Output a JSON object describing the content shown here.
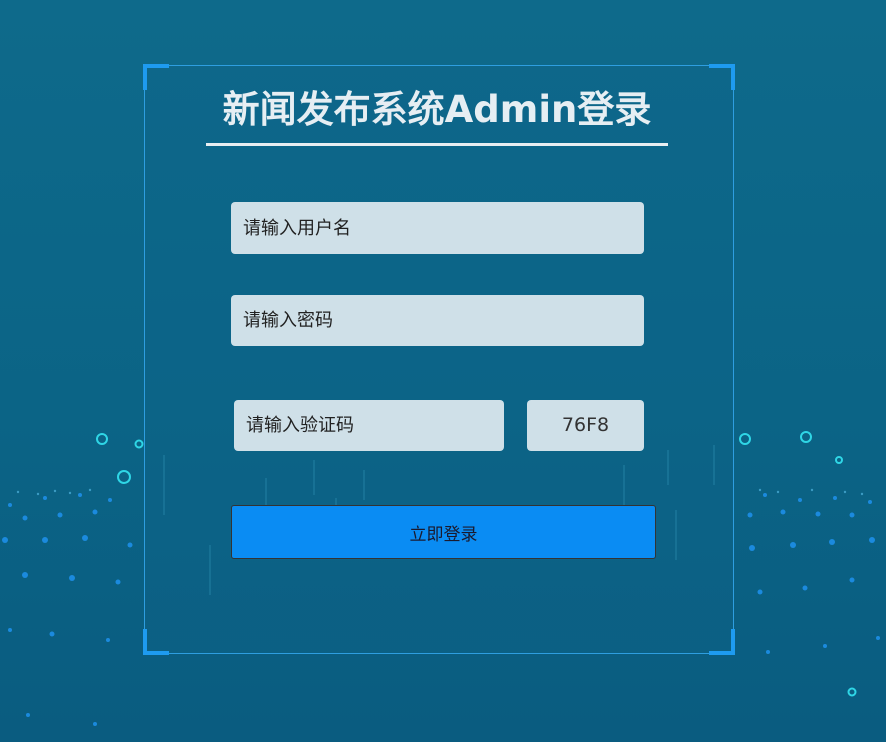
{
  "login": {
    "title": "新闻发布系统Admin登录",
    "username_placeholder": "请输入用户名",
    "password_placeholder": "请输入密码",
    "captcha_placeholder": "请输入验证码",
    "captcha_code": "76F8",
    "submit_label": "立即登录"
  },
  "colors": {
    "background": "#0e6a8b",
    "frame_border": "#2e9ee0",
    "corner_accent": "#1e9bf0",
    "input_bg": "#cfe0e8",
    "button_bg": "#0a8cf3",
    "title_text": "#e6eef3"
  }
}
